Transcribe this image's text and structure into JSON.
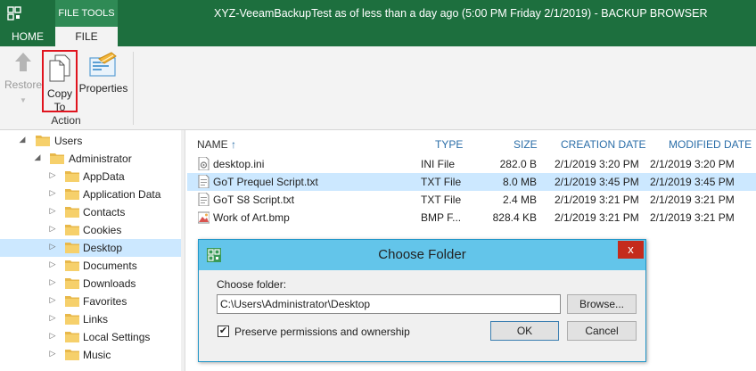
{
  "window": {
    "context_tab": "FILE TOOLS",
    "title": "XYZ-VeeamBackupTest as of less than a day ago (5:00 PM Friday 2/1/2019) - BACKUP BROWSER"
  },
  "ribbon_tabs": [
    {
      "label": "HOME",
      "active": false
    },
    {
      "label": "FILE",
      "active": true
    }
  ],
  "ribbon": {
    "restore_label": "Restore",
    "copy_to_label_line1": "Copy",
    "copy_to_label_line2": "To",
    "properties_label": "Properties",
    "group_label": "Action"
  },
  "tree": {
    "nodes": [
      {
        "label": "Users",
        "level": 0,
        "expanded": true,
        "selected": false
      },
      {
        "label": "Administrator",
        "level": 1,
        "expanded": true,
        "selected": false
      },
      {
        "label": "AppData",
        "level": 2,
        "expanded": false,
        "selected": false
      },
      {
        "label": "Application Data",
        "level": 2,
        "expanded": false,
        "selected": false
      },
      {
        "label": "Contacts",
        "level": 2,
        "expanded": false,
        "selected": false
      },
      {
        "label": "Cookies",
        "level": 2,
        "expanded": false,
        "selected": false
      },
      {
        "label": "Desktop",
        "level": 2,
        "expanded": false,
        "selected": true
      },
      {
        "label": "Documents",
        "level": 2,
        "expanded": false,
        "selected": false
      },
      {
        "label": "Downloads",
        "level": 2,
        "expanded": false,
        "selected": false
      },
      {
        "label": "Favorites",
        "level": 2,
        "expanded": false,
        "selected": false
      },
      {
        "label": "Links",
        "level": 2,
        "expanded": false,
        "selected": false
      },
      {
        "label": "Local Settings",
        "level": 2,
        "expanded": false,
        "selected": false
      },
      {
        "label": "Music",
        "level": 2,
        "expanded": false,
        "selected": false
      }
    ]
  },
  "file_list": {
    "columns": {
      "name": "NAME",
      "type": "TYPE",
      "size": "SIZE",
      "created": "CREATION DATE",
      "modified": "MODIFIED DATE"
    },
    "sort_indicator": "↑",
    "rows": [
      {
        "name": "desktop.ini",
        "type": "INI  File",
        "size": "282.0 B",
        "created": "2/1/2019 3:20 PM",
        "modified": "2/1/2019 3:20 PM",
        "icon": "ini-file-icon",
        "selected": false
      },
      {
        "name": "GoT Prequel Script.txt",
        "type": "TXT  File",
        "size": "8.0 MB",
        "created": "2/1/2019 3:45 PM",
        "modified": "2/1/2019 3:45 PM",
        "icon": "text-file-icon",
        "selected": true
      },
      {
        "name": "GoT S8 Script.txt",
        "type": "TXT  File",
        "size": "2.4 MB",
        "created": "2/1/2019 3:21 PM",
        "modified": "2/1/2019 3:21 PM",
        "icon": "text-file-icon",
        "selected": false
      },
      {
        "name": "Work of Art.bmp",
        "type": "BMP  F...",
        "size": "828.4 KB",
        "created": "2/1/2019 3:21 PM",
        "modified": "2/1/2019 3:21 PM",
        "icon": "bitmap-file-icon",
        "selected": false
      }
    ]
  },
  "dialog": {
    "title": "Choose Folder",
    "close_glyph": "x",
    "folder_label": "Choose folder:",
    "folder_value": "C:\\Users\\Administrator\\Desktop",
    "browse_label": "Browse...",
    "preserve_label": "Preserve permissions and ownership",
    "preserve_checked": true,
    "ok_label": "OK",
    "cancel_label": "Cancel"
  },
  "colors": {
    "title_bar": "#1d6f3e",
    "selection": "#cce8ff",
    "dialog_title": "#63c5ea",
    "close_button": "#c42b1c",
    "highlight_border": "#e0141e"
  }
}
